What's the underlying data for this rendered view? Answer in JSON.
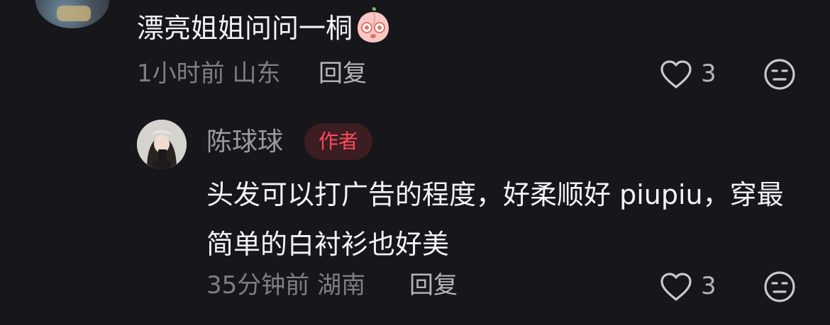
{
  "comments": [
    {
      "text": "漂亮姐姐问问一桐",
      "emoji": "peach-face-emoji",
      "time": "1小时前",
      "location": "山东",
      "reply_label": "回复",
      "likes": "3"
    },
    {
      "author": "陈球球",
      "author_badge": "作者",
      "text": "头发可以打广告的程度，好柔顺好 piupiu，穿最简单的白衬衫也好美",
      "time": "35分钟前",
      "location": "湖南",
      "reply_label": "回复",
      "likes": "3"
    }
  ],
  "icons": {
    "like": "heart-outline-icon",
    "dislike": "meh-face-icon"
  },
  "colors": {
    "background": "#16161b",
    "badge_text": "#ff4a5c",
    "badge_bg": "#3b1d22",
    "meta_text": "#7e7e86"
  }
}
